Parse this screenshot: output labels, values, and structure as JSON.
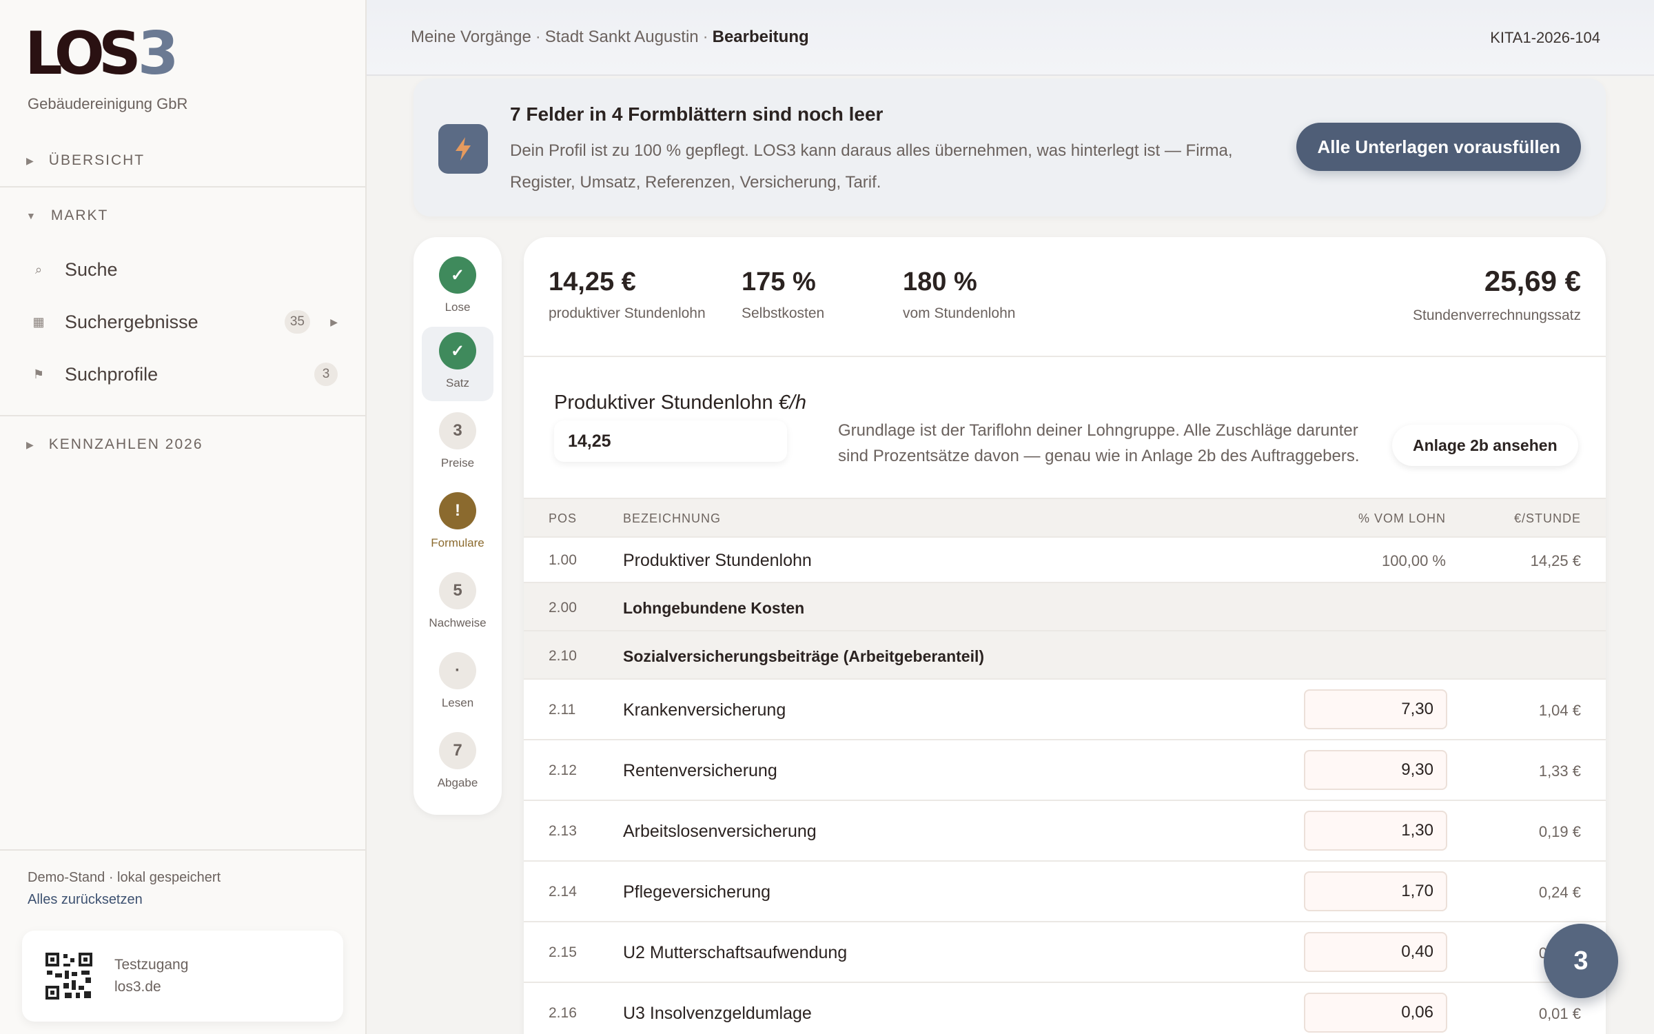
{
  "sidebar": {
    "logo_main": "LOS",
    "logo_accent": "3",
    "company": "Gebäudereinigung GbR",
    "sections": {
      "overview": "ÜBERSICHT",
      "market": "MARKT",
      "kpis": "KENNZAHLEN 2026"
    },
    "items": [
      {
        "label": "Suche",
        "icon": "search-icon"
      },
      {
        "label": "Suchergebnisse",
        "icon": "grid-icon",
        "badge": "35"
      },
      {
        "label": "Suchprofile",
        "icon": "flag-icon",
        "badge": "3"
      }
    ],
    "demo_status": "Demo-Stand · lokal gespeichert",
    "reset_link": "Alles zurücksetzen",
    "qr_card": {
      "line1": "Testzugang",
      "line2": "los3.de"
    }
  },
  "topbar": {
    "breadcrumb": [
      "Meine Vorgänge",
      "Stadt Sankt Augustin",
      "Bearbeitung"
    ],
    "separator": "·",
    "case_id": "KITA1-2026-104"
  },
  "banner": {
    "icon": "lightning-icon",
    "title": "7 Felder in 4 Formblättern sind noch leer",
    "text": "Dein Profil ist zu 100 % gepflegt. LOS3 kann daraus alles übernehmen, was hinterlegt ist — Firma, Register, Umsatz, Referenzen, Versicherung, Tarif.",
    "button": "Alle Unterlagen vorausfüllen"
  },
  "steps": [
    {
      "symbol": "✓",
      "label": "Lose",
      "state": "done"
    },
    {
      "symbol": "✓",
      "label": "Satz",
      "state": "done"
    },
    {
      "symbol": "3",
      "label": "Preise",
      "state": "todo"
    },
    {
      "symbol": "!",
      "label": "Formulare",
      "state": "warn"
    },
    {
      "symbol": "5",
      "label": "Nachweise",
      "state": "todo"
    },
    {
      "symbol": "·",
      "label": "Lesen",
      "state": "todo"
    },
    {
      "symbol": "7",
      "label": "Abgabe",
      "state": "todo"
    }
  ],
  "kpis": [
    {
      "value": "14,25 €",
      "label": "produktiver Stundenlohn"
    },
    {
      "value": "175 %",
      "label": "Selbstkosten"
    },
    {
      "value": "180 %",
      "label": "vom Stundenlohn"
    }
  ],
  "kpi_total": {
    "value": "25,69 €",
    "label": "Stundenverrechnungssatz"
  },
  "wage": {
    "title": "Produktiver Stundenlohn",
    "unit": "€/h",
    "value": "14,25",
    "help": "Grundlage ist der Tariflohn deiner Lohngruppe. Alle Zuschläge darunter sind Prozentsätze davon — genau wie in Anlage 2b des Auftraggebers.",
    "button": "Anlage 2b ansehen"
  },
  "table": {
    "headers": {
      "pos": "POS",
      "name": "BEZEICHNUNG",
      "pct": "% VOM LOHN",
      "eur": "€/STUNDE"
    },
    "rows": [
      {
        "pos": "1.00",
        "name": "Produktiver Stundenlohn",
        "pct": "100,00 %",
        "eur": "14,25 €"
      },
      {
        "pos": "2.00",
        "name": "Lohngebundene Kosten"
      },
      {
        "pos": "2.10",
        "name": "Sozialversicherungsbeiträge (Arbeitgeberanteil)"
      },
      {
        "pos": "2.11",
        "name": "Krankenversicherung",
        "pct": "7,30",
        "eur": "1,04 €"
      },
      {
        "pos": "2.12",
        "name": "Rentenversicherung",
        "pct": "9,30",
        "eur": "1,33 €"
      },
      {
        "pos": "2.13",
        "name": "Arbeitslosenversicherung",
        "pct": "1,30",
        "eur": "0,19 €"
      },
      {
        "pos": "2.14",
        "name": "Pflegeversicherung",
        "pct": "1,70",
        "eur": "0,24 €"
      },
      {
        "pos": "2.15",
        "name": "U2 Mutterschaftsaufwendung",
        "pct": "0,40",
        "eur": "0,06 €"
      },
      {
        "pos": "2.16",
        "name": "U3 Insolvenzgeldumlage",
        "pct": "0,06",
        "eur": "0,01 €"
      }
    ]
  },
  "fab": "3",
  "colors": {
    "accent": "#56667f",
    "success": "#3f8a5c",
    "warning": "#8b6a2e",
    "text": "#2b2321"
  }
}
